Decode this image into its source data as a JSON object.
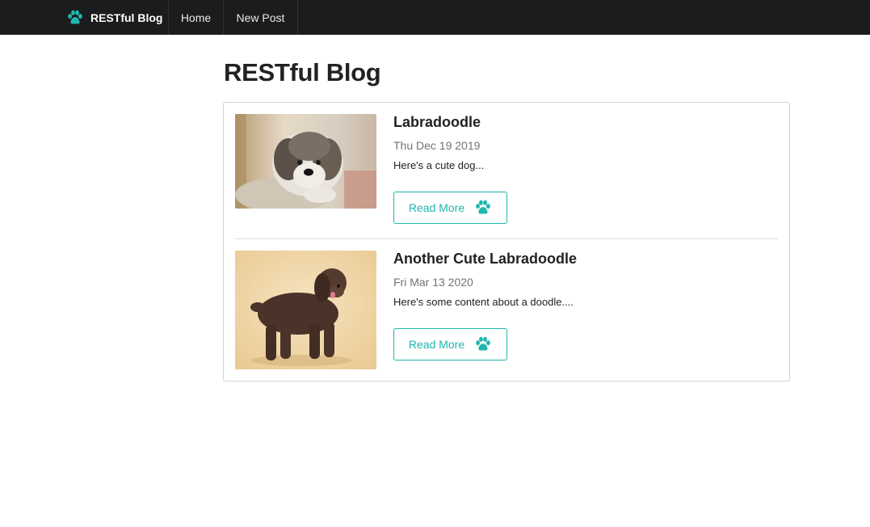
{
  "colors": {
    "accent": "#1fb6ad",
    "navbar_bg": "#1b1c1d"
  },
  "navbar": {
    "brand_label": "RESTful Blog",
    "brand_icon": "paw-icon",
    "items": [
      {
        "label": "Home"
      },
      {
        "label": "New Post"
      }
    ]
  },
  "page": {
    "title": "RESTful Blog"
  },
  "posts": [
    {
      "title": "Labradoodle",
      "date": "Thu Dec 19 2019",
      "excerpt": "Here's a cute dog...",
      "button_label": "Read More",
      "button_icon": "paw-icon"
    },
    {
      "title": "Another Cute Labradoodle",
      "date": "Fri Mar 13 2020",
      "excerpt": "Here's some content about a doodle....",
      "button_label": "Read More",
      "button_icon": "paw-icon"
    }
  ]
}
